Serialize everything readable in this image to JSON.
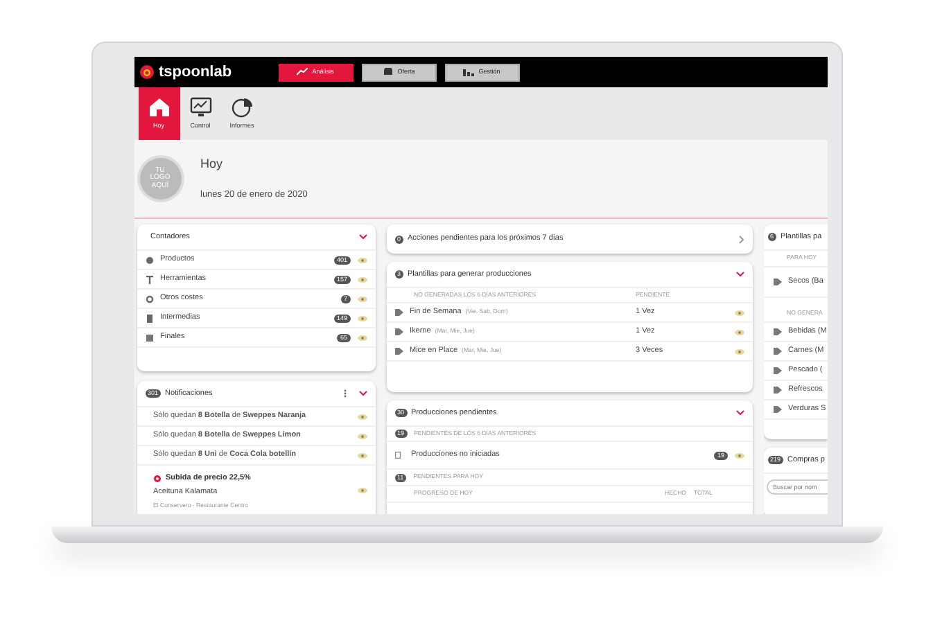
{
  "brand": "tspoonlab",
  "top_tabs": [
    {
      "label": "Análisis",
      "kind": "chart",
      "selected": true
    },
    {
      "label": "Oferta",
      "kind": "chef",
      "selected": false
    },
    {
      "label": "Gestión",
      "kind": "bars",
      "selected": false
    }
  ],
  "nav": [
    {
      "label": "Hoy",
      "kind": "home",
      "selected": true
    },
    {
      "label": "Control",
      "kind": "monitor",
      "selected": false
    },
    {
      "label": "Informes",
      "kind": "pie",
      "selected": false
    }
  ],
  "logo_placeholder": [
    "TU",
    "LOGO",
    "AQUÍ"
  ],
  "page": {
    "title": "Hoy",
    "date": "lunes 20 de enero de 2020"
  },
  "counters": {
    "title": "Contadores",
    "items": [
      {
        "label": "Productos",
        "count": "401",
        "kind": "product"
      },
      {
        "label": "Herramientas",
        "count": "157",
        "kind": "tool"
      },
      {
        "label": "Otros costes",
        "count": "7",
        "kind": "cost"
      },
      {
        "label": "Intermedias",
        "count": "149",
        "kind": "intermediate"
      },
      {
        "label": "Finales",
        "count": "65",
        "kind": "final"
      }
    ]
  },
  "notifications": {
    "count": "301",
    "title": "Notificaciones",
    "items": [
      {
        "kind": "stock",
        "text": "Sólo quedan **8 Botella** de **Sweppes Naranja**"
      },
      {
        "kind": "stock",
        "text": "Sólo quedan **8 Botella** de **Sweppes Limon**"
      },
      {
        "kind": "stock",
        "text": "Sólo quedan **8 Uni** de **Coca Cola botellín**"
      },
      {
        "kind": "price",
        "title": "Subida de precio 22,5%",
        "product": "Aceituna Kalamata",
        "source": "El Conservero - Restaurante Centro"
      }
    ]
  },
  "actions": {
    "count": "0",
    "title": "Acciones pendientes para los próximos 7 días"
  },
  "templates": {
    "count": "3",
    "title": "Plantillas para generar producciones",
    "columns": [
      "NO GENERADAS LOS 6 DÍAS ANTERIORES",
      "PENDIENTE"
    ],
    "rows": [
      {
        "name": "Fin de Semana",
        "days": "(Vie, Sab, Dom)",
        "pending": "1 Vez"
      },
      {
        "name": "Ikerne",
        "days": "(Mar, Mie, Jue)",
        "pending": "1 Vez"
      },
      {
        "name": "Mice en Place",
        "days": "(Mar, Mie, Jue)",
        "pending": "3 Veces"
      }
    ]
  },
  "productions": {
    "count": "30",
    "title": "Producciones pendientes",
    "previous": {
      "count": "19",
      "title": "PENDIENTES DE LOS 6 DÍAS ANTERIORES",
      "rows": [
        {
          "name": "Producciones no iniciadas",
          "count": "19"
        }
      ]
    },
    "today": {
      "count": "11",
      "title": "PENDIENTES PARA HOY",
      "columns": [
        "PROGRESO DE HOY",
        "HECHO",
        "TOTAL"
      ]
    }
  },
  "side_templates": {
    "count": "6",
    "title": "Plantillas pa",
    "sections": [
      {
        "title": "PARA HOY",
        "rows": [
          "Secos (Ba"
        ]
      },
      {
        "title": "NO GENERA",
        "rows": [
          "Bebidas (M",
          "Carnes (M",
          "Pescado (",
          "Refrescos",
          "Verduras S"
        ]
      }
    ]
  },
  "purchases": {
    "count": "219",
    "title": "Compras p",
    "search_placeholder": "Buscar por nom"
  }
}
